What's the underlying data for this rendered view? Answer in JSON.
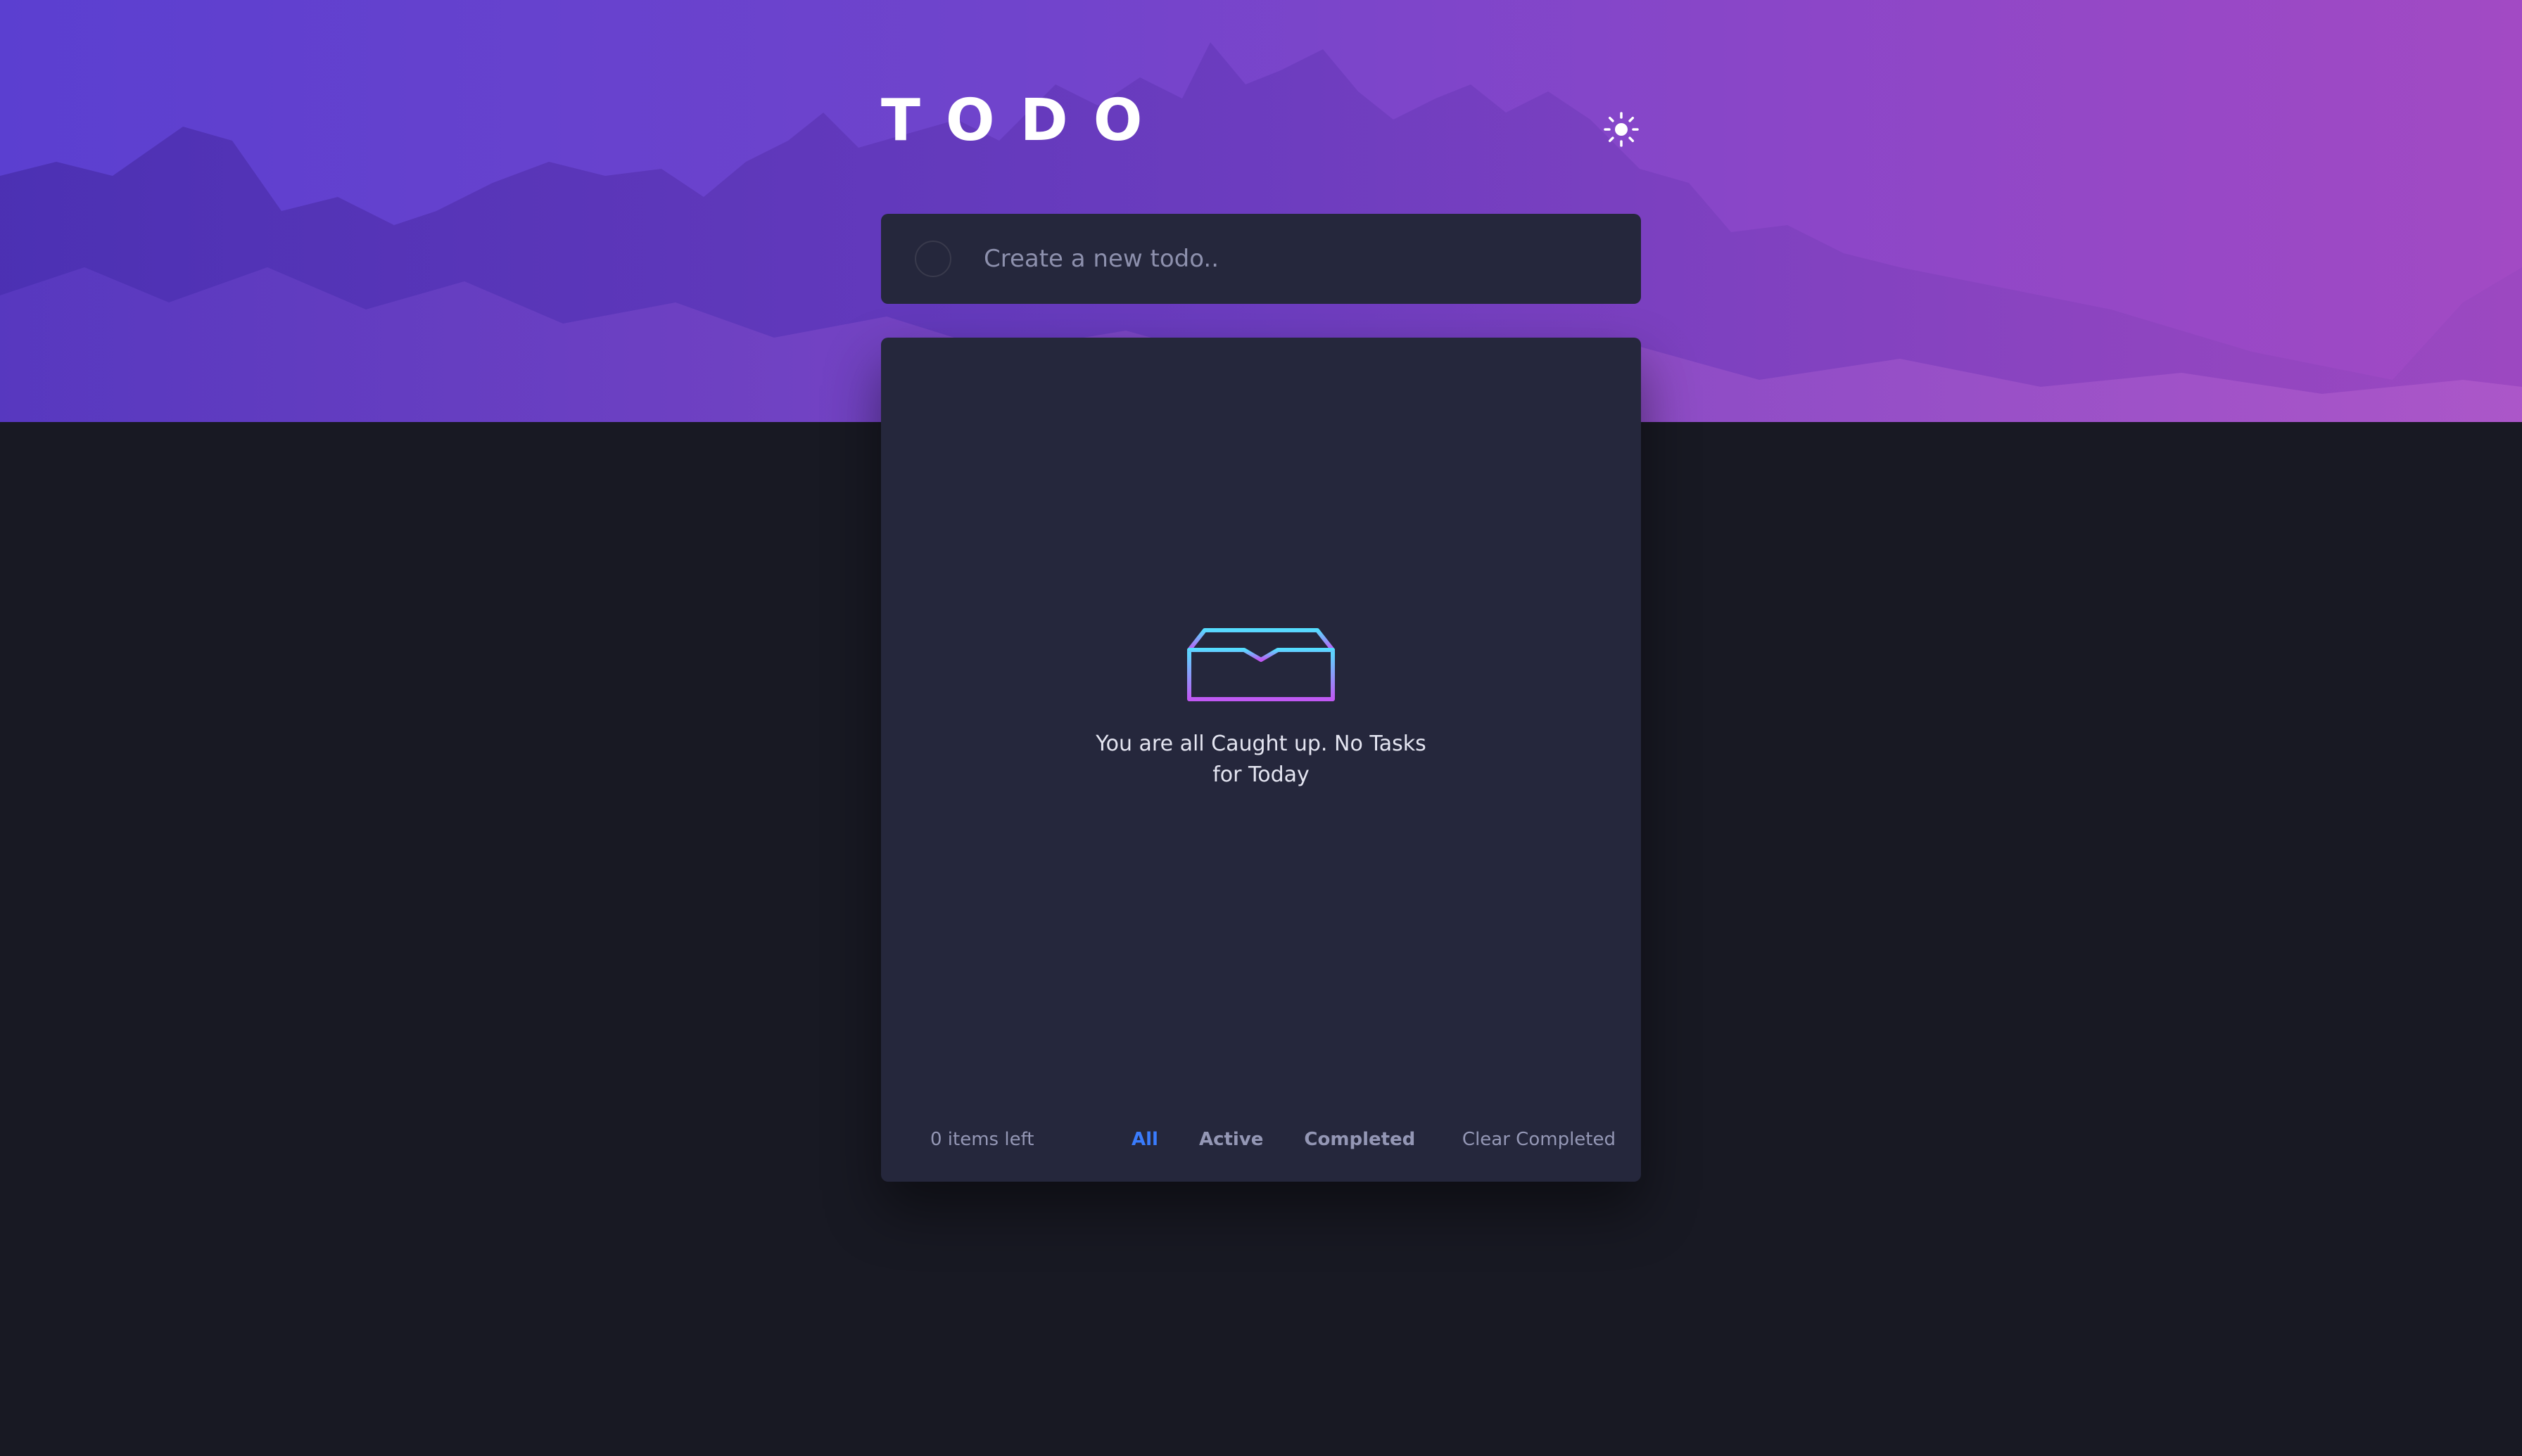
{
  "header": {
    "title": "TODO",
    "theme_icon": "sun-icon"
  },
  "new_todo": {
    "placeholder": "Create a new todo..",
    "value": ""
  },
  "empty_state": {
    "icon": "inbox-icon",
    "message": "You are all Caught up. No Tasks for Today"
  },
  "footer": {
    "items_left": "0 items left",
    "filters": [
      "All",
      "Active",
      "Completed"
    ],
    "active_filter": "All",
    "clear_label": "Clear Completed"
  },
  "colors": {
    "background": "#181923",
    "card": "#25273c",
    "accent": "#3a7cfd",
    "hero_start": "#5b3fd0",
    "hero_end": "#a24ac4",
    "icon_gradient_start": "#55ddff",
    "icon_gradient_end": "#c058f3"
  }
}
